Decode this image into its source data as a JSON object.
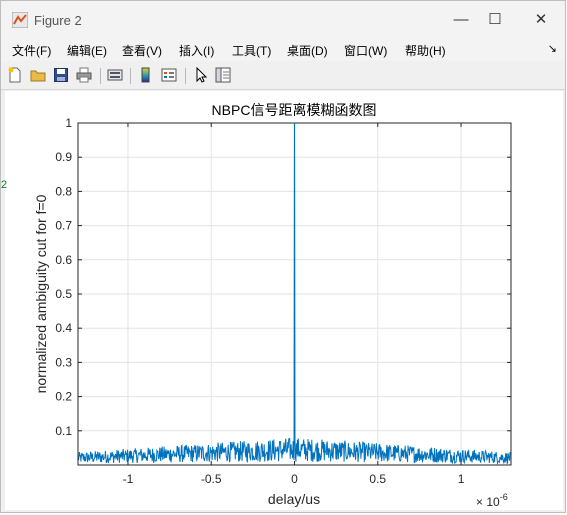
{
  "window": {
    "title": "Figure 2",
    "minimize": "—",
    "maximize": "☐",
    "close": "✕"
  },
  "menu": [
    {
      "label": "文件(F)"
    },
    {
      "label": "编辑(E)"
    },
    {
      "label": "查看(V)"
    },
    {
      "label": "插入(I)"
    },
    {
      "label": "工具(T)"
    },
    {
      "label": "桌面(D)"
    },
    {
      "label": "窗口(W)"
    },
    {
      "label": "帮助(H)"
    }
  ],
  "menu_overflow_icon": "arrow-icon",
  "toolbar_icons": [
    "new-figure-icon",
    "open-file-icon",
    "save-icon",
    "print-icon",
    "link-plot-icon",
    "colorbar-icon",
    "legend-icon",
    "pointer-icon",
    "property-inspector-icon"
  ],
  "side_fragment": "2",
  "chart_data": {
    "type": "line",
    "title": "NBPC信号距离模糊函数图",
    "xlabel": "delay/us",
    "ylabel": "normalized ambiguity cut for f=0",
    "x_exponent_label": "× 10",
    "x_exponent_power": "-6",
    "xlim": [
      -1.3e-06,
      1.3e-06
    ],
    "ylim": [
      0,
      1
    ],
    "xticks": [
      -1e-06,
      -5e-07,
      0,
      5e-07,
      1e-06
    ],
    "xtick_labels": [
      "-1",
      "-0.5",
      "0",
      "0.5",
      "1"
    ],
    "yticks": [
      0.1,
      0.2,
      0.3,
      0.4,
      0.5,
      0.6,
      0.7,
      0.8,
      0.9,
      1
    ],
    "ytick_labels": [
      "0.1",
      "0.2",
      "0.3",
      "0.4",
      "0.5",
      "0.6",
      "0.7",
      "0.8",
      "0.9",
      "1"
    ],
    "grid": true,
    "series": [
      {
        "color": "#0072bd",
        "peak": {
          "x": 0,
          "y": 1
        },
        "sidelobe_level_edges": 0.03,
        "sidelobe_level_center": 0.065,
        "sidelobe_max": 0.09
      }
    ]
  }
}
